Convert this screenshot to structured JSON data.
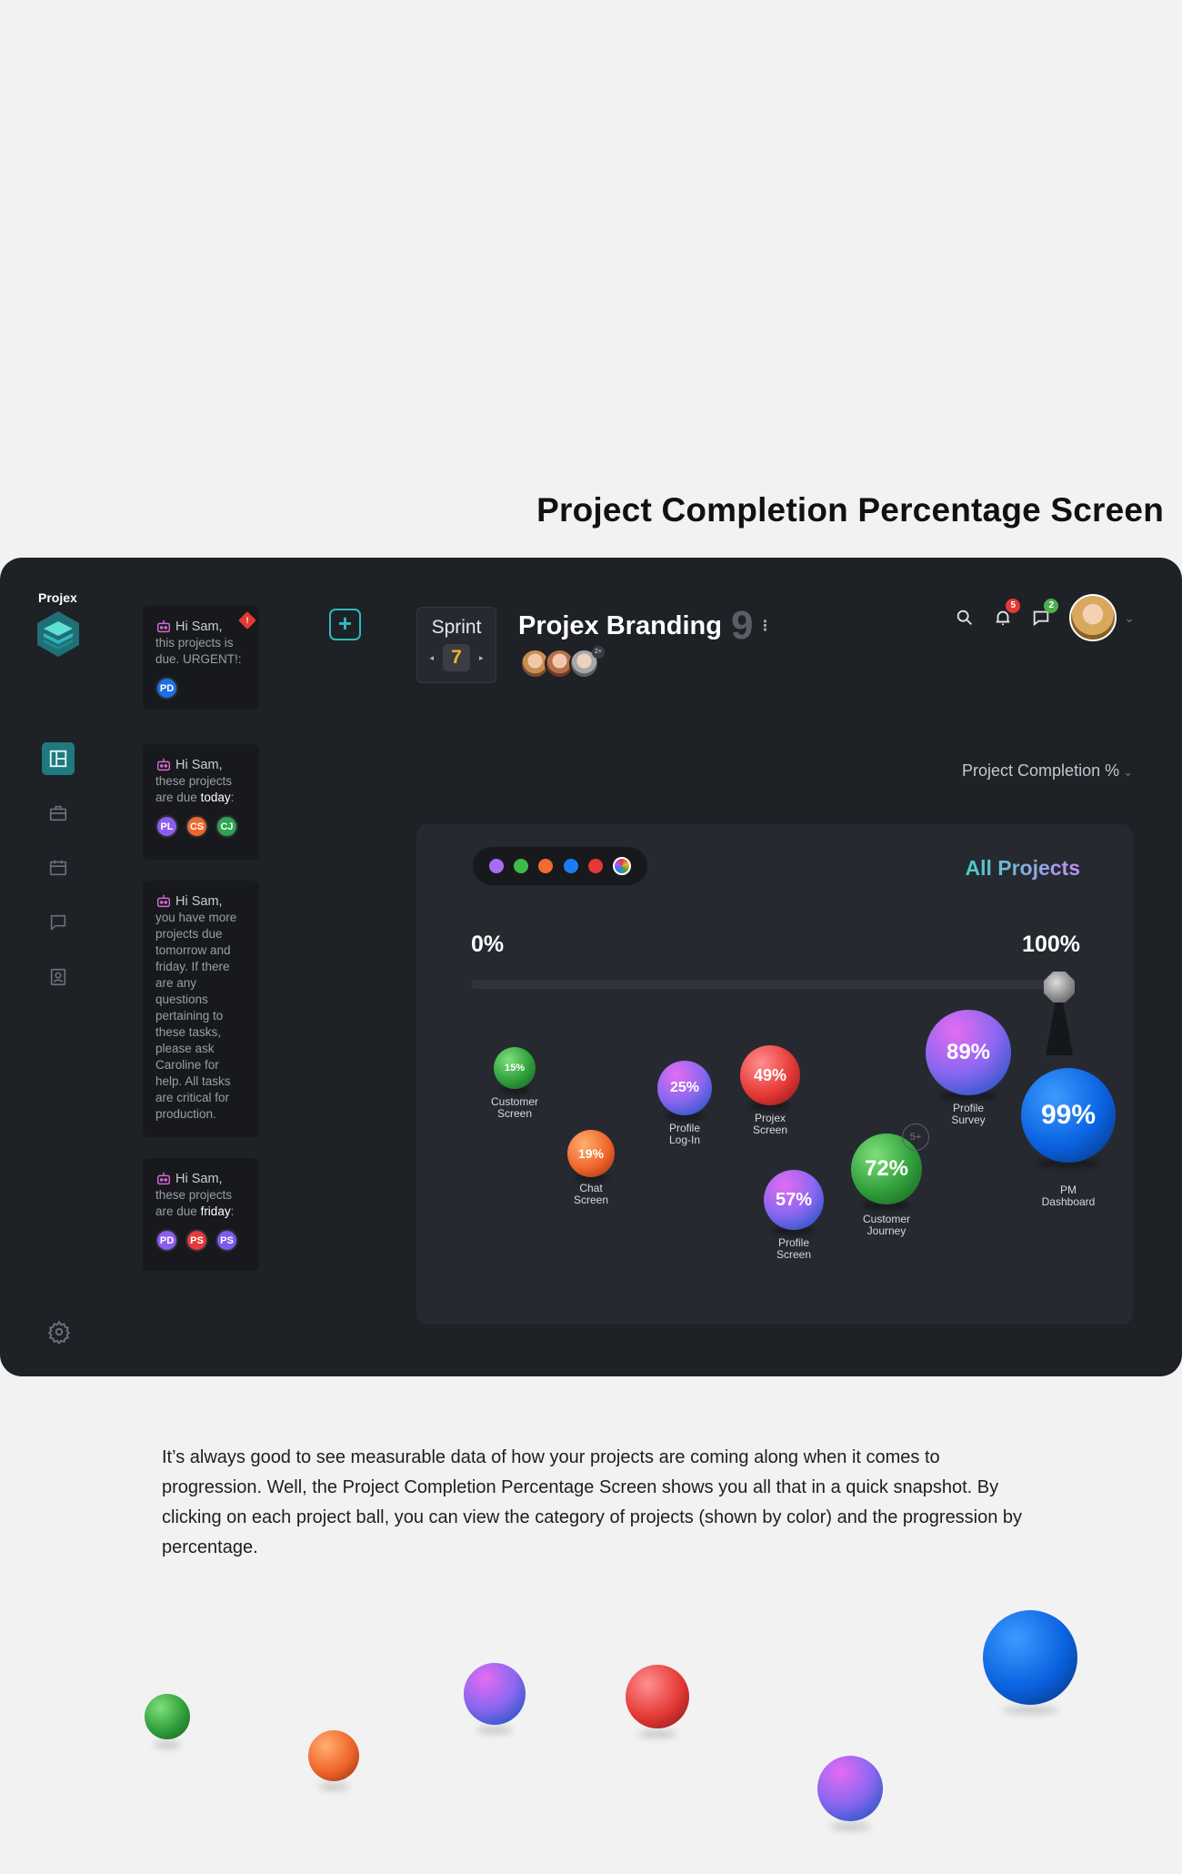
{
  "page_heading": "Project Completion Percentage Screen",
  "app": {
    "brand": "Projex",
    "nav_items": [
      "dashboard-icon",
      "briefcase-icon",
      "calendar-icon",
      "chat-icon",
      "contacts-icon"
    ],
    "notes": [
      {
        "greeting": "Hi Sam,",
        "text": "this projects is due. URGENT!:",
        "urgent": "!",
        "chips": [
          {
            "label": "PD",
            "color": "#1e6ee8"
          }
        ]
      },
      {
        "greeting": "Hi Sam,",
        "text": "these projects are due",
        "highlight": "today",
        "tail": ":",
        "chips": [
          {
            "label": "PL",
            "color": "#8e5cf0"
          },
          {
            "label": "CS",
            "color": "#f0672a"
          },
          {
            "label": "CJ",
            "color": "#2ea44f"
          }
        ]
      },
      {
        "greeting": "Hi Sam,",
        "text": "you have more projects due tomorrow and friday. If there are any questions pertaining to these tasks, please ask Caroline for help. All tasks are critical for production."
      },
      {
        "greeting": "Hi Sam,",
        "text": "these projects are due",
        "highlight": "friday",
        "tail": ":",
        "chips": [
          {
            "label": "PD",
            "color": "#8e5cf0"
          },
          {
            "label": "PS",
            "color": "#e5393b"
          },
          {
            "label": "PS",
            "color": "#7a5cf0"
          }
        ]
      }
    ],
    "add_button": "+",
    "sprint": {
      "label": "Sprint",
      "number": "7",
      "prev": "◂",
      "next": "▸"
    },
    "project": {
      "title": "Projex Branding",
      "count": "9",
      "team_more": "2+"
    },
    "notifications": {
      "bell_count": "5",
      "chat_count": "2",
      "bell_color": "#e53935",
      "chat_color": "#4caf50"
    },
    "filter": {
      "label": "Project Completion %",
      "chevron": "⌄"
    },
    "panel": {
      "all_projects": "All Projects",
      "range_min": "0%",
      "range_max": "100%",
      "category_colors": [
        "#a86cf6",
        "#3fb84a",
        "#f26a30",
        "#1e7cf0",
        "#e53935"
      ],
      "more_label": "5+",
      "balls": [
        {
          "pct": "15%",
          "label": [
            "Customer",
            "Screen"
          ],
          "color": "green"
        },
        {
          "pct": "19%",
          "label": [
            "Chat",
            "Screen"
          ],
          "color": "orange"
        },
        {
          "pct": "25%",
          "label": [
            "Profile",
            "Log-In"
          ],
          "color": "purple"
        },
        {
          "pct": "49%",
          "label": [
            "Projex",
            "Screen"
          ],
          "color": "red"
        },
        {
          "pct": "57%",
          "label": [
            "Profile",
            "Screen"
          ],
          "color": "purple"
        },
        {
          "pct": "72%",
          "label": [
            "Customer",
            "Journey"
          ],
          "color": "green"
        },
        {
          "pct": "89%",
          "label": [
            "Profile",
            "Survey"
          ],
          "color": "purple"
        },
        {
          "pct": "99%",
          "label": [
            "PM",
            "Dashboard"
          ],
          "color": "blue"
        }
      ]
    }
  },
  "description": "It’s always good to see measurable data of how your projects are coming along when it comes to progression. Well, the Project Completion Percentage Screen shows you all that in a quick snapshot. By clicking on each project ball, you can view the category of projects (shown by color) and the progression by percentage."
}
